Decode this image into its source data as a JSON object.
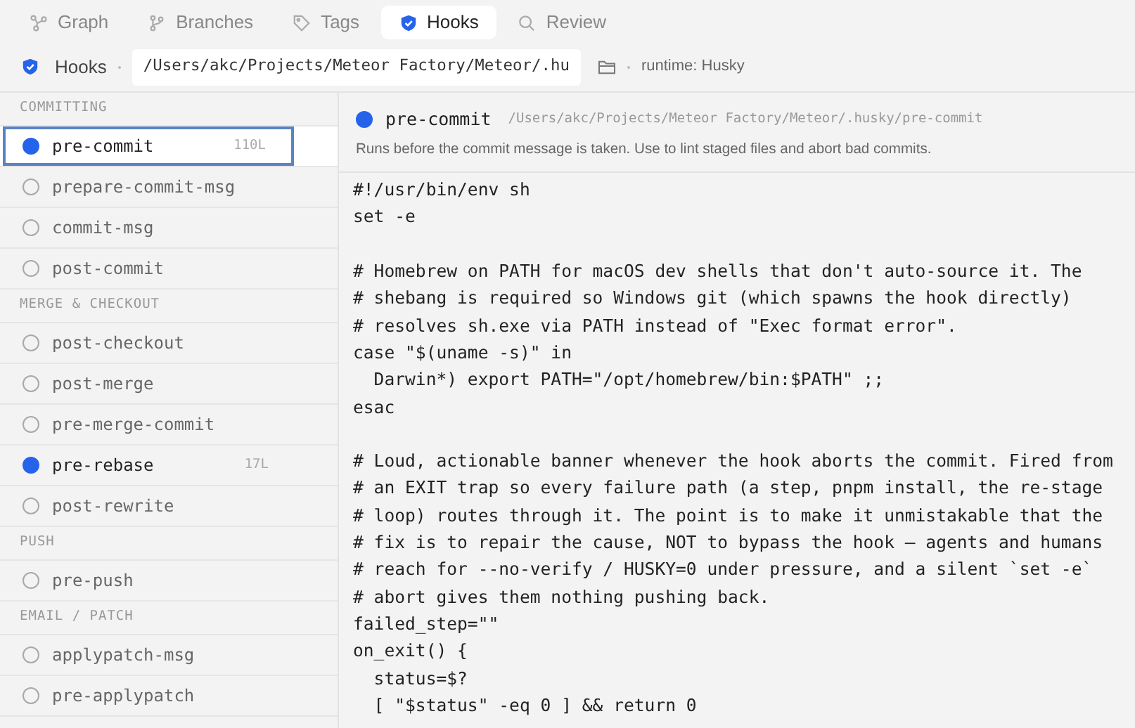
{
  "tabs": [
    {
      "label": "Graph",
      "kind": "graph",
      "selected": false
    },
    {
      "label": "Branches",
      "kind": "branches",
      "selected": false
    },
    {
      "label": "Tags",
      "kind": "tags",
      "selected": false
    },
    {
      "label": "Hooks",
      "kind": "hooks",
      "selected": true
    },
    {
      "label": "Review",
      "kind": "review",
      "selected": false
    }
  ],
  "toolbar": {
    "title": "Hooks",
    "path": "/Users/akc/Projects/Meteor Factory/Meteor/.hu",
    "runtime": "runtime: Husky"
  },
  "sidebar": {
    "sections": [
      {
        "title": "COMMITTING",
        "items": [
          {
            "name": "pre-commit",
            "installed": true,
            "selected": true,
            "lines": "110L"
          },
          {
            "name": "prepare-commit-msg",
            "installed": false,
            "selected": false
          },
          {
            "name": "commit-msg",
            "installed": false,
            "selected": false
          },
          {
            "name": "post-commit",
            "installed": false,
            "selected": false
          }
        ]
      },
      {
        "title": "MERGE & CHECKOUT",
        "items": [
          {
            "name": "post-checkout",
            "installed": false,
            "selected": false
          },
          {
            "name": "post-merge",
            "installed": false,
            "selected": false
          },
          {
            "name": "pre-merge-commit",
            "installed": false,
            "selected": false
          },
          {
            "name": "pre-rebase",
            "installed": true,
            "selected": false,
            "lines": "17L"
          },
          {
            "name": "post-rewrite",
            "installed": false,
            "selected": false
          }
        ]
      },
      {
        "title": "PUSH",
        "items": [
          {
            "name": "pre-push",
            "installed": false,
            "selected": false
          }
        ]
      },
      {
        "title": "EMAIL / PATCH",
        "items": [
          {
            "name": "applypatch-msg",
            "installed": false,
            "selected": false
          },
          {
            "name": "pre-applypatch",
            "installed": false,
            "selected": false
          }
        ]
      }
    ]
  },
  "editor": {
    "name": "pre-commit",
    "installed": true,
    "path": "/Users/akc/Projects/Meteor Factory/Meteor/.husky/pre-commit",
    "description": "Runs before the commit message is taken. Use to lint staged files and abort bad commits.",
    "code_blocks": [
      [
        "#!/usr/bin/env sh",
        "set -e"
      ],
      [
        "# Homebrew on PATH for macOS dev shells that don't auto-source it. The",
        "# shebang is required so Windows git (which spawns the hook directly)",
        "# resolves sh.exe via PATH instead of \"Exec format error\".",
        "case \"$(uname -s)\" in",
        "  Darwin*) export PATH=\"/opt/homebrew/bin:$PATH\" ;;",
        "esac"
      ],
      [
        "# Loud, actionable banner whenever the hook aborts the commit. Fired from",
        "# an EXIT trap so every failure path (a step, pnpm install, the re-stage",
        "# loop) routes through it. The point is to make it unmistakable that the",
        "# fix is to repair the cause, NOT to bypass the hook — agents and humans",
        "# reach for --no-verify / HUSKY=0 under pressure, and a silent `set -e`",
        "# abort gives them nothing pushing back.",
        "failed_step=\"\"",
        "on_exit() {",
        "  status=$?",
        "  [ \"$status\" -eq 0 ] && return 0"
      ]
    ]
  }
}
